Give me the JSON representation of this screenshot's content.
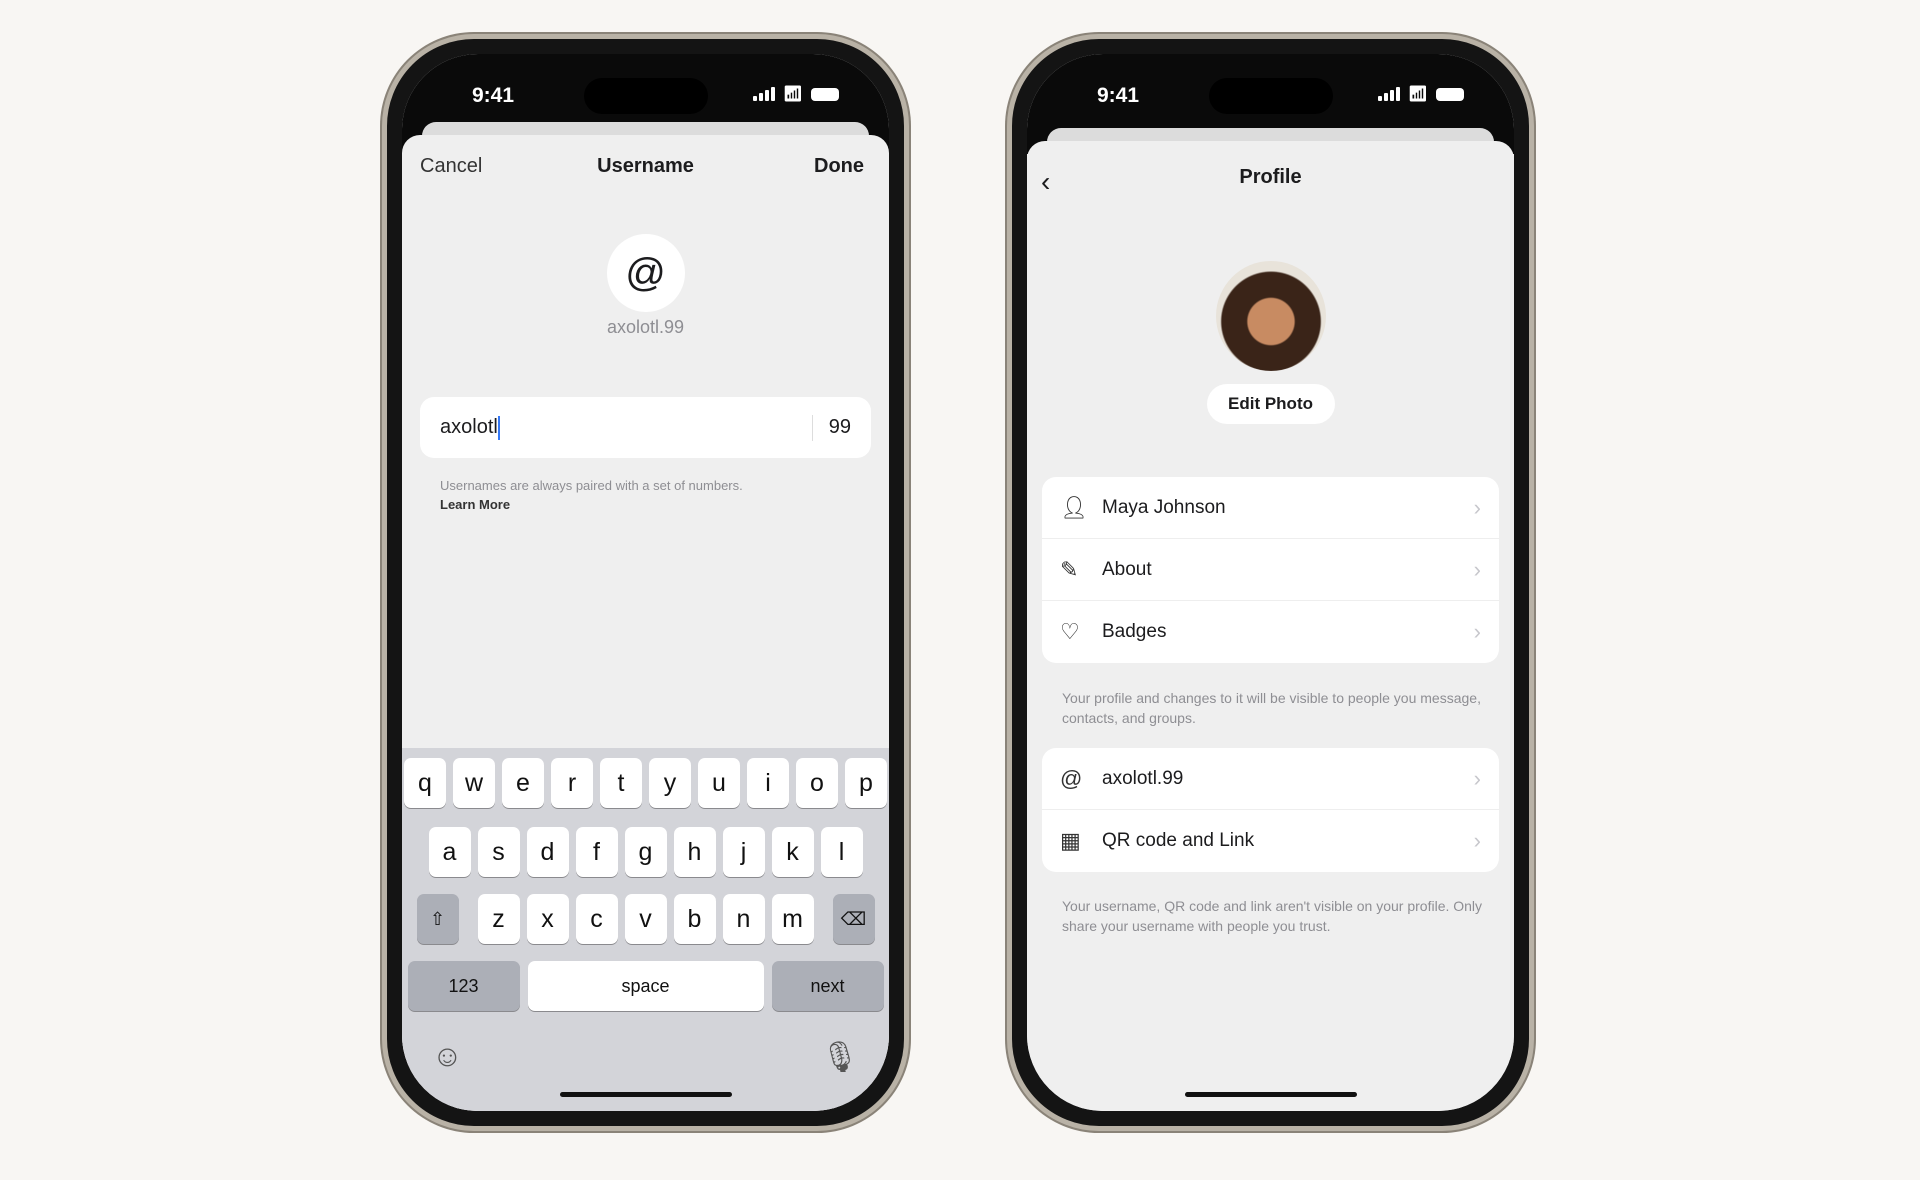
{
  "status_bar": {
    "time": "9:41"
  },
  "username_screen": {
    "cancel": "Cancel",
    "title": "Username",
    "done": "Done",
    "icon": "at-icon",
    "preview": "axolotl.99",
    "input_value": "axolotl",
    "suffix": "99",
    "help_text": "Usernames are always paired with a set of numbers.",
    "learn_more": "Learn More",
    "keyboard": {
      "row1": [
        "q",
        "w",
        "e",
        "r",
        "t",
        "y",
        "u",
        "i",
        "o",
        "p"
      ],
      "row2": [
        "a",
        "s",
        "d",
        "f",
        "g",
        "h",
        "j",
        "k",
        "l"
      ],
      "row3": [
        "z",
        "x",
        "c",
        "v",
        "b",
        "n",
        "m"
      ],
      "numbers": "123",
      "space": "space",
      "next": "next"
    }
  },
  "profile_screen": {
    "title": "Profile",
    "edit_photo": "Edit Photo",
    "group1": [
      {
        "icon": "person-icon",
        "label": "Maya Johnson"
      },
      {
        "icon": "pencil-icon",
        "label": "About"
      },
      {
        "icon": "badges-icon",
        "label": "Badges"
      }
    ],
    "footer1": "Your profile and changes to it will be visible to people you message, contacts, and groups.",
    "group2": [
      {
        "icon": "at-icon",
        "label": "axolotl.99"
      },
      {
        "icon": "qr-code-icon",
        "label": "QR code and Link"
      }
    ],
    "footer2": "Your username, QR code and link aren't visible on your profile. Only share your username with people you trust."
  }
}
